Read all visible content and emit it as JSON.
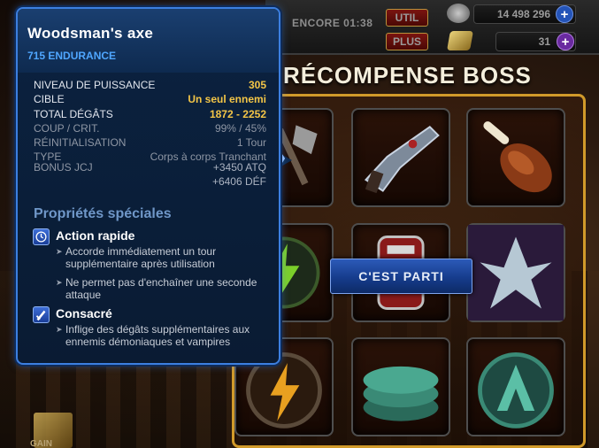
{
  "hud": {
    "encore_label": "ENCORE 01:38",
    "util_button": "UTIL",
    "plus_button": "PLUS",
    "gold_amount": "14 498 296",
    "gem_amount": "31",
    "plus_symbol": "+"
  },
  "reward": {
    "title": "RÉCOMPENSE BOSS",
    "go_button": "C'EST PARTI",
    "gold_caption": "GAIN"
  },
  "tooltip": {
    "item_name": "Woodsman's axe",
    "subtitle": "715 ENDURANCE",
    "stats": [
      {
        "label": "NIVEAU DE PUISSANCE",
        "value": "305"
      },
      {
        "label": "CIBLE",
        "value": "Un seul ennemi"
      },
      {
        "label": "TOTAL DÉGÂTS",
        "value": "1872 - 2252"
      },
      {
        "label": "COUP / CRIT.",
        "value": "99% / 45%"
      },
      {
        "label": "RÉINITIALISATION",
        "value": "1 Tour"
      },
      {
        "label": "TYPE",
        "value": "Corps à corps Tranchant"
      }
    ],
    "bonus_label": "BONUS JCJ",
    "bonus_values": [
      "+3450 ATQ",
      "+6406 DÉF"
    ],
    "props_title": "Propriétés spéciales",
    "abilities": [
      {
        "name": "Action rapide",
        "icon": "clock-icon",
        "bullets": [
          "Accorde immédiatement un tour supplémentaire après utilisation",
          "Ne permet pas d'enchaîner une seconde attaque"
        ]
      },
      {
        "name": "Consacré",
        "icon": "blade-icon",
        "bullets": [
          "Inflige des dégâts supplémentaires aux ennemis démoniaques et vampires"
        ]
      }
    ]
  },
  "slots": [
    {
      "icon": "axe-icon"
    },
    {
      "icon": "rifle-icon"
    },
    {
      "icon": "meat-icon"
    },
    {
      "icon": "energy-bolt-icon"
    },
    {
      "icon": "canister-icon"
    },
    {
      "icon": "crystal-icon"
    },
    {
      "icon": "energy-bolt-icon"
    },
    {
      "icon": "avengers-coins-icon"
    },
    {
      "icon": "avengers-coin-icon"
    }
  ]
}
